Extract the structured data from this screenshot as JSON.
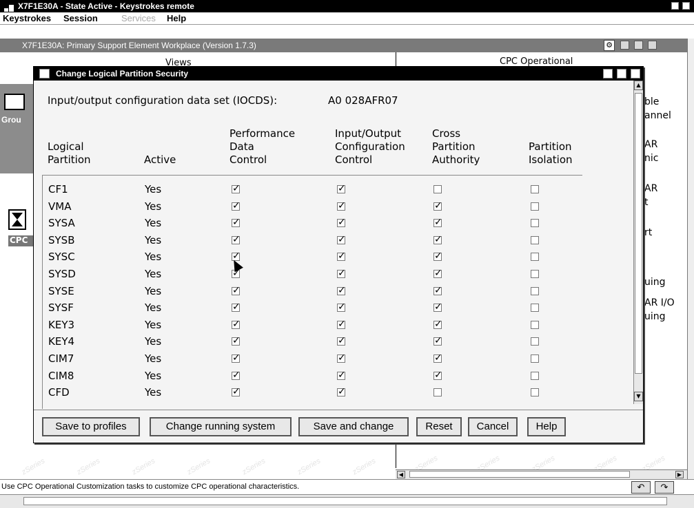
{
  "outer_window": {
    "title": "X7F1E30A - State Active - Keystrokes remote",
    "menu": [
      "Keystrokes",
      "Session",
      "Services",
      "Help"
    ]
  },
  "workplace": {
    "title": "X7F1E30A: Primary Support Element Workplace (Version 1.7.3)",
    "views_title": "Views",
    "group_label": "Grou",
    "cpc_label": "CPC",
    "right_header": "CPC Operational",
    "right_items": [
      "ble",
      "annel",
      "AR",
      "nic",
      "AR",
      "t",
      "rt",
      "uing",
      "AR I/O",
      "uing"
    ],
    "watermark": "zSeries"
  },
  "dialog": {
    "title": "Change Logical Partition Security",
    "iocds_label": "Input/output configuration data set (IOCDS):",
    "iocds_value": "A0 028AFR07",
    "headers": {
      "partition": [
        "Logical",
        "Partition"
      ],
      "active": [
        "Active"
      ],
      "perf": [
        "Performance",
        "Data",
        "Control"
      ],
      "io": [
        "Input/Output",
        "Configuration",
        "Control"
      ],
      "cross": [
        "Cross",
        "Partition",
        "Authority"
      ],
      "iso": [
        "Partition",
        "Isolation"
      ]
    },
    "rows": [
      {
        "name": "CF1",
        "active": "Yes",
        "perf": true,
        "io": true,
        "cross": false,
        "iso": false
      },
      {
        "name": "VMA",
        "active": "Yes",
        "perf": true,
        "io": true,
        "cross": true,
        "iso": false
      },
      {
        "name": "SYSA",
        "active": "Yes",
        "perf": true,
        "io": true,
        "cross": true,
        "iso": false
      },
      {
        "name": "SYSB",
        "active": "Yes",
        "perf": true,
        "io": true,
        "cross": true,
        "iso": false
      },
      {
        "name": "SYSC",
        "active": "Yes",
        "perf": true,
        "io": true,
        "cross": true,
        "iso": false
      },
      {
        "name": "SYSD",
        "active": "Yes",
        "perf": true,
        "io": true,
        "cross": true,
        "iso": false
      },
      {
        "name": "SYSE",
        "active": "Yes",
        "perf": true,
        "io": true,
        "cross": true,
        "iso": false
      },
      {
        "name": "SYSF",
        "active": "Yes",
        "perf": true,
        "io": true,
        "cross": true,
        "iso": false
      },
      {
        "name": "KEY3",
        "active": "Yes",
        "perf": true,
        "io": true,
        "cross": true,
        "iso": false
      },
      {
        "name": "KEY4",
        "active": "Yes",
        "perf": true,
        "io": true,
        "cross": true,
        "iso": false
      },
      {
        "name": "CIM7",
        "active": "Yes",
        "perf": true,
        "io": true,
        "cross": true,
        "iso": false
      },
      {
        "name": "CIM8",
        "active": "Yes",
        "perf": true,
        "io": true,
        "cross": true,
        "iso": false
      },
      {
        "name": "CFD",
        "active": "Yes",
        "perf": true,
        "io": true,
        "cross": false,
        "iso": false
      }
    ],
    "buttons": [
      "Save to profiles",
      "Change running system",
      "Save and change",
      "Reset",
      "Cancel",
      "Help"
    ]
  },
  "status_text": "Use CPC Operational Customization tasks to customize CPC operational characteristics."
}
